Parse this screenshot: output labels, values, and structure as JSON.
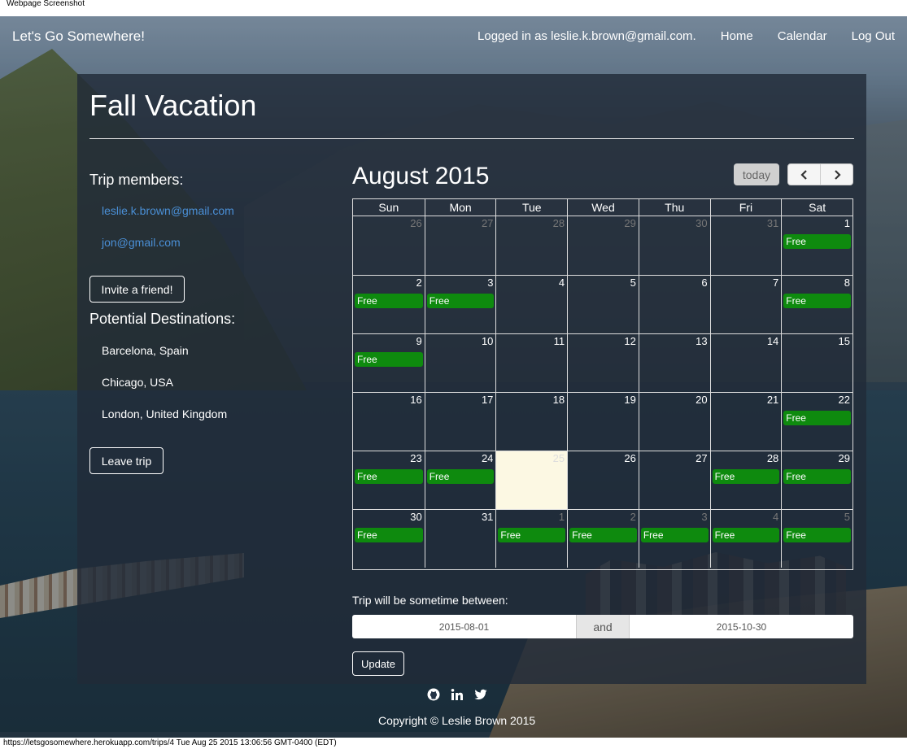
{
  "print": {
    "header": "Webpage Screenshot",
    "footer": "https://letsgosomewhere.herokuapp.com/trips/4 Tue Aug 25 2015 13:06:56 GMT-0400 (EDT)"
  },
  "nav": {
    "brand": "Let's Go Somewhere!",
    "logged_in": "Logged in as leslie.k.brown@gmail.com.",
    "links": [
      "Home",
      "Calendar",
      "Log Out"
    ]
  },
  "trip": {
    "title": "Fall Vacation",
    "members_heading": "Trip members:",
    "members": [
      "leslie.k.brown@gmail.com",
      "jon@gmail.com"
    ],
    "invite_label": "Invite a friend!",
    "destinations_heading": "Potential Destinations:",
    "destinations": [
      "Barcelona, Spain",
      "Chicago, USA",
      "London, United Kingdom"
    ],
    "leave_label": "Leave trip"
  },
  "calendar": {
    "title": "August 2015",
    "today_label": "today",
    "prev_icon": "chevron-left-icon",
    "next_icon": "chevron-right-icon",
    "weekdays": [
      "Sun",
      "Mon",
      "Tue",
      "Wed",
      "Thu",
      "Fri",
      "Sat"
    ],
    "event_label": "Free",
    "today_date": "25",
    "days": [
      {
        "d": "26",
        "other": true,
        "free": false
      },
      {
        "d": "27",
        "other": true,
        "free": false
      },
      {
        "d": "28",
        "other": true,
        "free": false
      },
      {
        "d": "29",
        "other": true,
        "free": false
      },
      {
        "d": "30",
        "other": true,
        "free": false
      },
      {
        "d": "31",
        "other": true,
        "free": false
      },
      {
        "d": "1",
        "other": false,
        "free": true
      },
      {
        "d": "2",
        "other": false,
        "free": true
      },
      {
        "d": "3",
        "other": false,
        "free": true
      },
      {
        "d": "4",
        "other": false,
        "free": false
      },
      {
        "d": "5",
        "other": false,
        "free": false
      },
      {
        "d": "6",
        "other": false,
        "free": false
      },
      {
        "d": "7",
        "other": false,
        "free": false
      },
      {
        "d": "8",
        "other": false,
        "free": true
      },
      {
        "d": "9",
        "other": false,
        "free": true
      },
      {
        "d": "10",
        "other": false,
        "free": false
      },
      {
        "d": "11",
        "other": false,
        "free": false
      },
      {
        "d": "12",
        "other": false,
        "free": false
      },
      {
        "d": "13",
        "other": false,
        "free": false
      },
      {
        "d": "14",
        "other": false,
        "free": false
      },
      {
        "d": "15",
        "other": false,
        "free": false
      },
      {
        "d": "16",
        "other": false,
        "free": false
      },
      {
        "d": "17",
        "other": false,
        "free": false
      },
      {
        "d": "18",
        "other": false,
        "free": false
      },
      {
        "d": "19",
        "other": false,
        "free": false
      },
      {
        "d": "20",
        "other": false,
        "free": false
      },
      {
        "d": "21",
        "other": false,
        "free": false
      },
      {
        "d": "22",
        "other": false,
        "free": true
      },
      {
        "d": "23",
        "other": false,
        "free": true
      },
      {
        "d": "24",
        "other": false,
        "free": true
      },
      {
        "d": "25",
        "other": false,
        "free": false,
        "today": true
      },
      {
        "d": "26",
        "other": false,
        "free": false
      },
      {
        "d": "27",
        "other": false,
        "free": false
      },
      {
        "d": "28",
        "other": false,
        "free": true
      },
      {
        "d": "29",
        "other": false,
        "free": true
      },
      {
        "d": "30",
        "other": false,
        "free": true
      },
      {
        "d": "31",
        "other": false,
        "free": false
      },
      {
        "d": "1",
        "other": true,
        "free": true
      },
      {
        "d": "2",
        "other": true,
        "free": true
      },
      {
        "d": "3",
        "other": true,
        "free": true
      },
      {
        "d": "4",
        "other": true,
        "free": true
      },
      {
        "d": "5",
        "other": true,
        "free": true
      }
    ]
  },
  "range": {
    "label": "Trip will be sometime between:",
    "start": "2015-08-01",
    "and_label": "and",
    "end": "2015-10-30",
    "update_label": "Update"
  },
  "footer": {
    "icons": [
      "github-icon",
      "linkedin-icon",
      "twitter-icon"
    ],
    "copyright": "Copyright © Leslie Brown 2015"
  },
  "colors": {
    "event_green": "#0e8a0e",
    "member_link": "#4a8fd6",
    "today_highlight": "#fcf8e3"
  }
}
